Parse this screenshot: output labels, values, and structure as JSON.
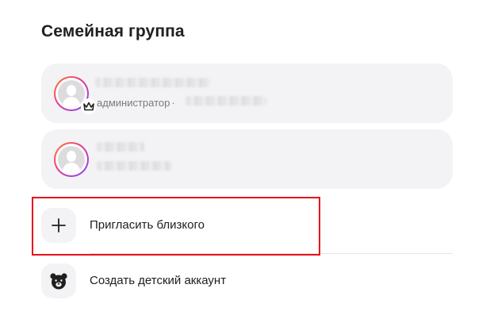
{
  "section": {
    "title": "Семейная группа"
  },
  "members": [
    {
      "avatar_icon": "user-silhouette-icon",
      "badge_icon": "crown-icon",
      "role": "администратор",
      "separator": "·"
    },
    {
      "avatar_icon": "user-silhouette-icon"
    }
  ],
  "actions": {
    "invite": {
      "icon": "plus-icon",
      "label": "Пригласить близкого"
    },
    "child_account": {
      "icon": "bear-face-icon",
      "label": "Создать детский аккаунт"
    }
  },
  "colors": {
    "card_bg": "#f3f3f5",
    "highlight_border": "#e8101a",
    "avatar_gradient": [
      "#ff7a2f",
      "#e83a8a",
      "#7d48ff"
    ],
    "secondary_text": "#7a7a80"
  }
}
